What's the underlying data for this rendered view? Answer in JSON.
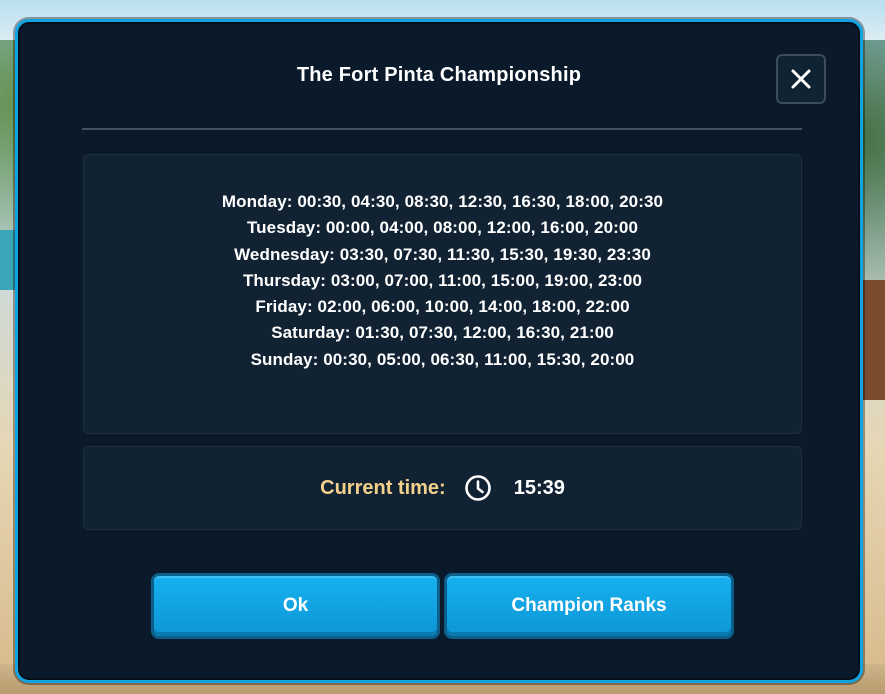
{
  "dialog": {
    "title": "The Fort Pinta Championship",
    "close_icon": "close-icon"
  },
  "schedule": [
    "Monday: 00:30, 04:30, 08:30, 12:30, 16:30, 18:00, 20:30",
    "Tuesday: 00:00, 04:00, 08:00, 12:00, 16:00, 20:00",
    "Wednesday: 03:30, 07:30, 11:30, 15:30, 19:30, 23:30",
    "Thursday: 03:00, 07:00, 11:00, 15:00, 19:00, 23:00",
    "Friday: 02:00, 06:00, 10:00, 14:00, 18:00, 22:00",
    "Saturday: 01:30, 07:30, 12:00, 16:30, 21:00",
    "Sunday: 00:30, 05:00, 06:30, 11:00, 15:30, 20:00"
  ],
  "current_time": {
    "label": "Current time:",
    "icon": "clock-icon",
    "value": "15:39"
  },
  "buttons": {
    "ok_label": "Ok",
    "champion_ranks_label": "Champion Ranks"
  },
  "colors": {
    "accent": "#12a4e0",
    "panel_bg": "#0a1a2b",
    "time_label": "#f3d08c"
  }
}
